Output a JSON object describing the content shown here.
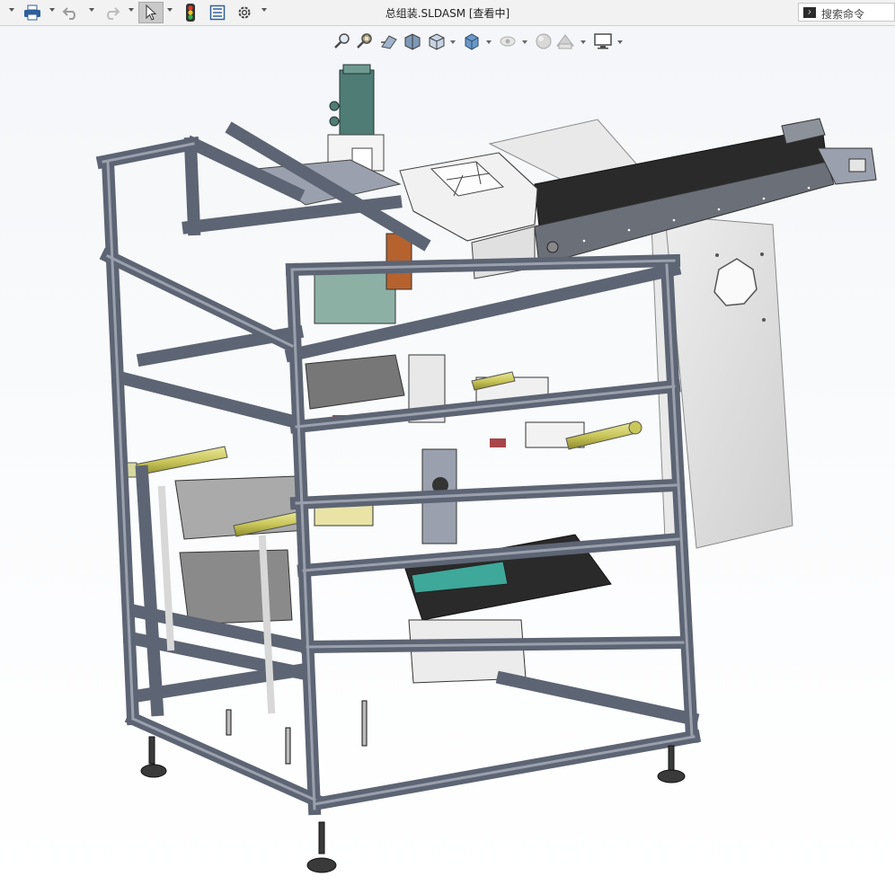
{
  "window": {
    "title": "总组装.SLDASM [查看中]"
  },
  "toolbar": {
    "buttons": [
      {
        "name": "print-button",
        "icon": "printer-icon"
      },
      {
        "name": "undo-button",
        "icon": "undo-icon"
      },
      {
        "name": "redo-button",
        "icon": "redo-icon"
      },
      {
        "name": "select-button",
        "icon": "pointer-icon"
      },
      {
        "name": "rebuild-button",
        "icon": "traffic-light-icon"
      },
      {
        "name": "file-properties-button",
        "icon": "properties-icon"
      },
      {
        "name": "options-button",
        "icon": "gear-icon"
      }
    ]
  },
  "search": {
    "placeholder": "搜索命令",
    "icon": "terminal-icon"
  },
  "view_toolbar": {
    "items": [
      {
        "name": "zoom-to-fit-button",
        "icon": "zoom-fit-icon"
      },
      {
        "name": "zoom-area-button",
        "icon": "zoom-area-icon"
      },
      {
        "name": "previous-view-button",
        "icon": "previous-view-icon"
      },
      {
        "name": "section-view-button",
        "icon": "section-view-icon"
      },
      {
        "name": "view-orientation-button",
        "icon": "view-orientation-icon"
      },
      {
        "name": "display-style-button",
        "icon": "display-style-icon"
      },
      {
        "name": "hide-show-button",
        "icon": "hide-show-icon"
      },
      {
        "name": "appearance-button",
        "icon": "appearance-icon"
      },
      {
        "name": "scene-button",
        "icon": "scene-icon"
      },
      {
        "name": "view-settings-button",
        "icon": "monitor-icon"
      }
    ]
  },
  "colors": {
    "frame": "#5d6473",
    "frame_light": "#9aa0ad",
    "cylinder": "#c9c65a",
    "belt": "#2a2a2a",
    "motor": "#4f7c74",
    "panel": "#e3e3e3"
  }
}
